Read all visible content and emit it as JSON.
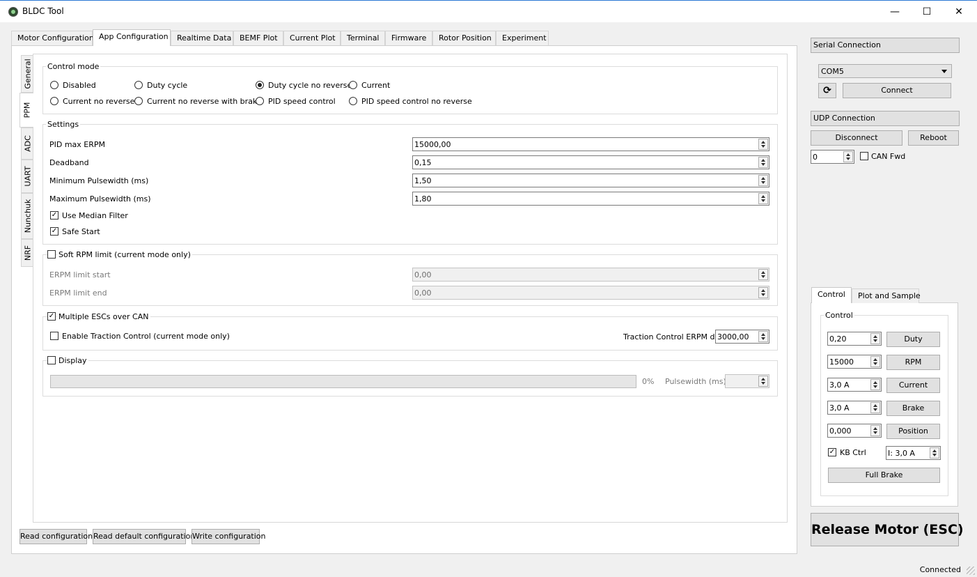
{
  "window": {
    "title": "BLDC Tool",
    "minimize_glyph": "—",
    "maximize_glyph": "☐",
    "close_glyph": "✕"
  },
  "main_tabs": [
    "Motor Configuration",
    "App Configuration",
    "Realtime Data",
    "BEMF Plot",
    "Current Plot",
    "Terminal",
    "Firmware",
    "Rotor Position",
    "Experiment"
  ],
  "active_main_tab": "App Configuration",
  "side_tabs": [
    "General",
    "PPM",
    "ADC",
    "UART",
    "Nunchuk",
    "NRF"
  ],
  "active_side_tab": "PPM",
  "control_mode": {
    "title": "Control mode",
    "options": [
      "Disabled",
      "Duty cycle",
      "Duty cycle no reverse",
      "Current",
      "Current no reverse",
      "Current no reverse with brake",
      "PID speed control",
      "PID speed control no reverse"
    ],
    "selected": "Duty cycle no reverse"
  },
  "settings": {
    "title": "Settings",
    "pid_max_erpm_label": "PID max ERPM",
    "pid_max_erpm": "15000,00",
    "deadband_label": "Deadband",
    "deadband": "0,15",
    "min_pulse_label": "Minimum Pulsewidth (ms)",
    "min_pulse": "1,50",
    "max_pulse_label": "Maximum Pulsewidth (ms)",
    "max_pulse": "1,80",
    "median_filter_label": "Use Median Filter",
    "median_filter": true,
    "safe_start_label": "Safe Start",
    "safe_start": true
  },
  "soft_rpm": {
    "title": "Soft RPM limit (current mode only)",
    "enabled": false,
    "start_label": "ERPM limit start",
    "start": "0,00",
    "end_label": "ERPM limit end",
    "end": "0,00"
  },
  "can": {
    "title": "Multiple ESCs over CAN",
    "enabled": true,
    "traction_label": "Enable Traction Control (current mode only)",
    "traction": false,
    "traction_diff_label": "Traction Control ERPM diff",
    "traction_diff": "3000,00"
  },
  "display": {
    "title": "Display",
    "enabled": false,
    "progress_text": "0%",
    "progress": 0,
    "pulsewidth_label": "Pulsewidth (ms):"
  },
  "bottom_buttons": {
    "read": "Read configuration",
    "read_default": "Read default configuration",
    "write": "Write configuration"
  },
  "serial": {
    "title": "Serial Connection",
    "port": "COM5",
    "refresh_glyph": "⟳",
    "connect_label": "Connect"
  },
  "udp": {
    "title": "UDP Connection",
    "disconnect_label": "Disconnect",
    "reboot_label": "Reboot",
    "can_id": "0",
    "can_fwd_label": "CAN Fwd",
    "can_fwd": false
  },
  "control_tabs": [
    "Control",
    "Plot and Sample"
  ],
  "active_control_tab": "Control",
  "control": {
    "title": "Control",
    "duty": "0,20",
    "duty_btn": "Duty",
    "rpm": "15000",
    "rpm_btn": "RPM",
    "current": "3,0 A",
    "current_btn": "Current",
    "brake": "3,0 A",
    "brake_btn": "Brake",
    "position": "0,000",
    "position_btn": "Position",
    "kb_ctrl_label": "KB Ctrl",
    "kb_ctrl": true,
    "kb_current": "I: 3,0 A",
    "full_brake": "Full Brake"
  },
  "release_label": "Release Motor (ESC)",
  "status": "Connected",
  "icons": {
    "check": "✓"
  }
}
